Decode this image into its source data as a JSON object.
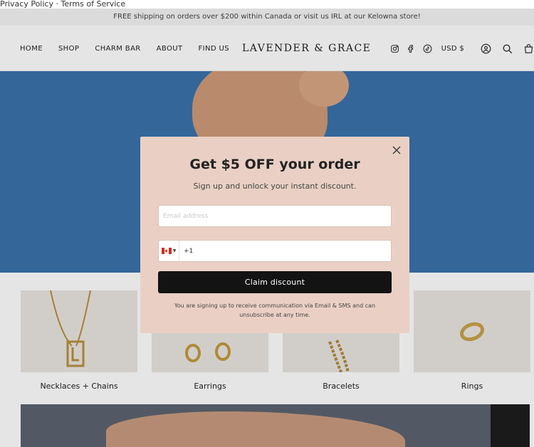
{
  "legal": {
    "privacy": "Privacy Policy",
    "separator": " · ",
    "terms": "Terms of Service"
  },
  "announcement": "FREE shipping on orders over $200 within Canada or visit us IRL at our Kelowna store!",
  "nav": {
    "home": "HOME",
    "shop": "SHOP",
    "charm_bar": "CHARM BAR",
    "about": "ABOUT",
    "find_us": "FIND US"
  },
  "logo": "LAVENDER & GRACE",
  "header_right": {
    "icons": [
      "instagram-icon",
      "facebook-icon",
      "tiktok-icon"
    ],
    "currency": "USD $",
    "utility_icons": [
      "account-icon",
      "search-icon",
      "cart-icon"
    ]
  },
  "categories": [
    {
      "label": "Necklaces + Chains"
    },
    {
      "label": "Earrings"
    },
    {
      "label": "Bracelets"
    },
    {
      "label": "Rings"
    }
  ],
  "modal": {
    "title": "Get $5 OFF your order",
    "subtitle": "Sign up and unlock your instant discount.",
    "email_placeholder": "Email address",
    "phone_code": "+1",
    "flag": "Canada",
    "claim_label": "Claim discount",
    "disclaimer": "You are signing up to receive communication via Email & SMS and can unsubscribe at any time."
  },
  "colors": {
    "modal_bg": "#ead0c4",
    "button_bg": "#131313",
    "hero_bg": "#3a72ac"
  }
}
